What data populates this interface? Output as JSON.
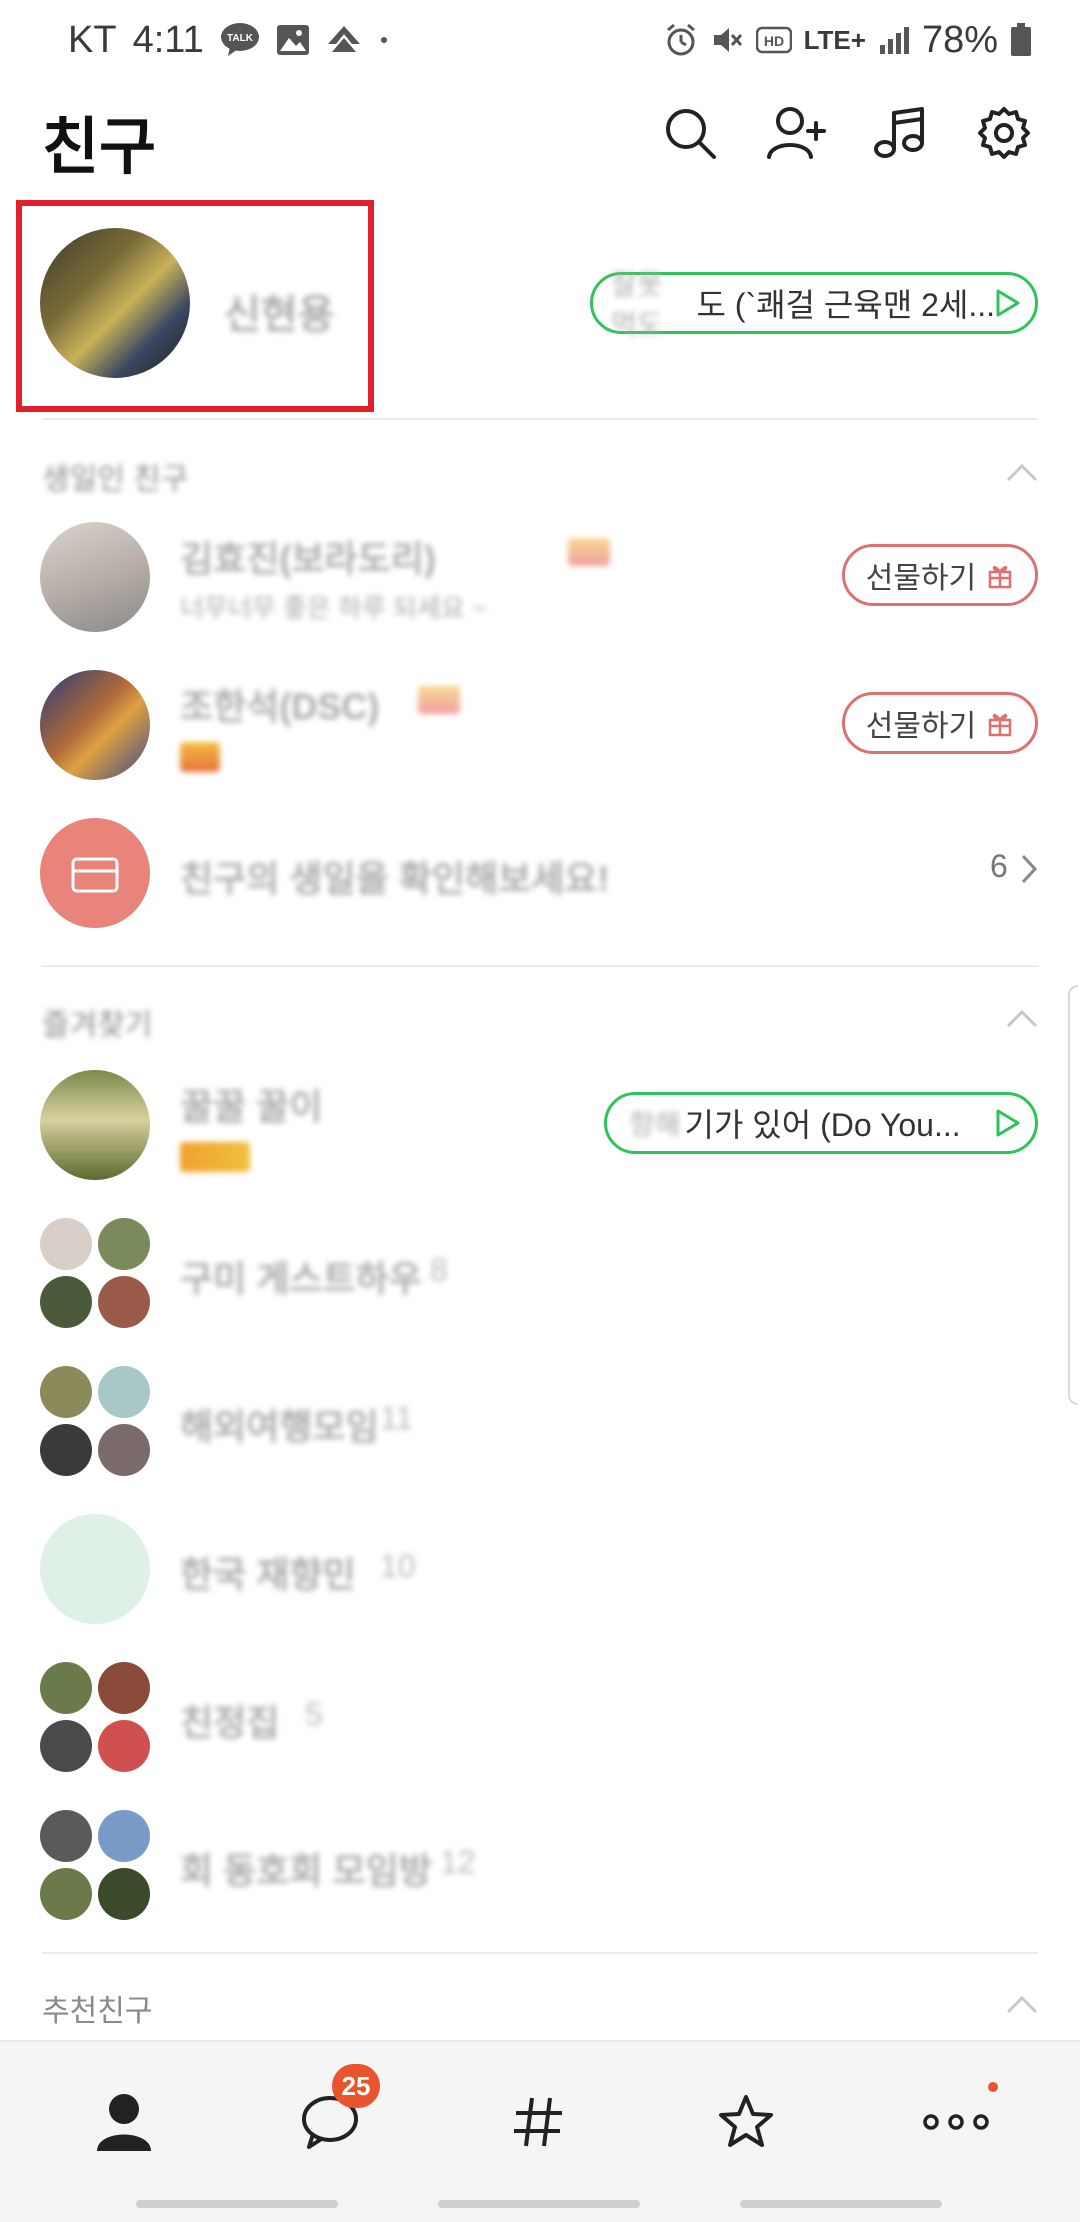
{
  "status_bar": {
    "carrier": "KT",
    "time": "4:11",
    "talk_label": "TALK",
    "network": "LTE+",
    "battery": "78%"
  },
  "header": {
    "title": "친구",
    "icons": [
      "search-icon",
      "add-friend-icon",
      "music-icon",
      "settings-icon"
    ]
  },
  "my_profile": {
    "name": "신현용",
    "music_prefix": "잘못 먹도",
    "music_text": "도 (`쾌걸 근육맨 2세..."
  },
  "birthday_section": {
    "label": "생일인 친구",
    "friends": [
      {
        "name": "김효진(보라도리)",
        "status": "너무너무 좋은 하루 되세요 ~",
        "gift_label": "선물하기"
      },
      {
        "name": "조한석(DSC)",
        "status": "",
        "gift_label": "선물하기"
      }
    ],
    "more_text": "친구의 생일을 확인해보세요!",
    "more_count": "6"
  },
  "favorites_section": {
    "label": "즐겨찾기",
    "friends": [
      {
        "name": "꿀꿀 꿀이",
        "status": "",
        "music_prefix": "항해",
        "music_text": "기가 있어 (Do You..."
      },
      {
        "name": "구미 게스트하우",
        "count": "8"
      },
      {
        "name": "해외여행모임",
        "count": "11"
      },
      {
        "name": "한국 재향민",
        "count": "10"
      },
      {
        "name": "친정집",
        "count": "5"
      },
      {
        "name": "회 동호회 모임방",
        "count": "12"
      }
    ]
  },
  "recommend_section": {
    "label": "추천친구"
  },
  "bottom_nav": {
    "chat_badge": "25",
    "items": [
      "friends-icon",
      "chat-icon",
      "hashtag-icon",
      "star-icon",
      "more-icon"
    ]
  },
  "colors": {
    "highlight_box": "#e0202a",
    "music_green": "#2ec45a",
    "gift_red": "#e07070",
    "badge_orange": "#e8542c"
  }
}
